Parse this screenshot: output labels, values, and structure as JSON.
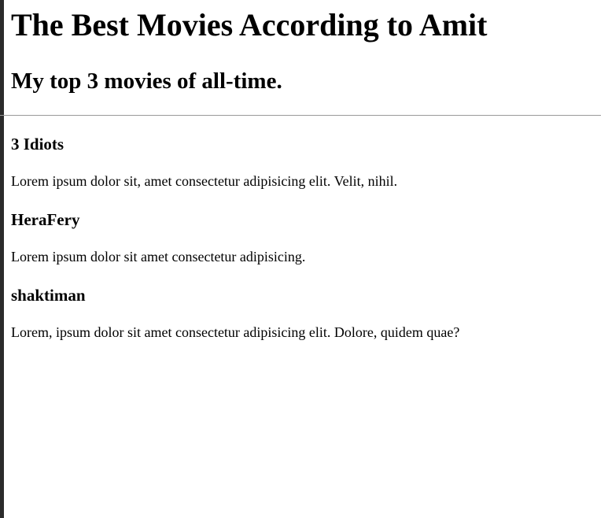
{
  "page": {
    "title": "The Best Movies According to Amit",
    "subtitle": "My top 3 movies of all-time."
  },
  "movies": [
    {
      "title": "3 Idiots",
      "description": "Lorem ipsum dolor sit, amet consectetur adipisicing elit. Velit, nihil."
    },
    {
      "title": "HeraFery",
      "description": "Lorem ipsum dolor sit amet consectetur adipisicing."
    },
    {
      "title": "shaktiman",
      "description": "Lorem, ipsum dolor sit amet consectetur adipisicing elit. Dolore, quidem quae?"
    }
  ]
}
